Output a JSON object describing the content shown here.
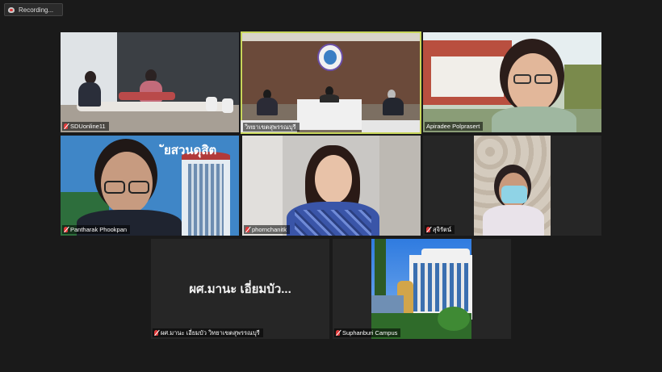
{
  "recording": {
    "label": "Recording..."
  },
  "tiles": [
    {
      "name": "SDUonline11"
    },
    {
      "name": "วิทยาเขตสุพรรณบุรี"
    },
    {
      "name": "Apiradee Polprasert"
    },
    {
      "name": "Pantharak Phookpan"
    },
    {
      "name": "phornchanitk"
    },
    {
      "name": "สุจิรัตน์"
    },
    {
      "name": "ผศ.มานะ เอี่ยมบัว วิทยาเขตสุพรรณบุรี",
      "display_name": "ผศ.มานะ เอี่ยมบัว..."
    },
    {
      "name": "Suphanburi Campus"
    }
  ],
  "banner_text": "ัยสวนดุสิต",
  "colors": {
    "active_border": "#c8d65a",
    "muted_mic": "#e03a3a",
    "background": "#1a1a1a"
  }
}
